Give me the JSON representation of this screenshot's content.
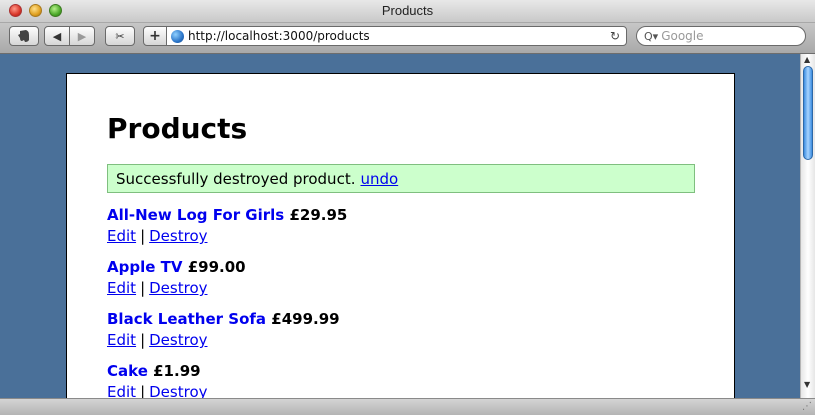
{
  "window": {
    "title": "Products"
  },
  "toolbar": {
    "evernote_icon": "evernote-elephant-icon",
    "back_icon": "◀",
    "forward_icon": "▶",
    "snippet_icon": "✂",
    "add_label": "+",
    "url": "http://localhost:3000/products",
    "reload_icon": "↻",
    "search_placeholder": "Google",
    "search_icon": "Q▾"
  },
  "page": {
    "title": "Products",
    "notice": {
      "text": "Successfully destroyed product.",
      "link": "undo"
    },
    "products": [
      {
        "name": "All-New Log For Girls",
        "price": "£29.95",
        "edit": "Edit",
        "destroy": "Destroy",
        "separator": "|"
      },
      {
        "name": "Apple TV",
        "price": "£99.00",
        "edit": "Edit",
        "destroy": "Destroy",
        "separator": "|"
      },
      {
        "name": "Black Leather Sofa",
        "price": "£499.99",
        "edit": "Edit",
        "destroy": "Destroy",
        "separator": "|"
      },
      {
        "name": "Cake",
        "price": "£1.99",
        "edit": "Edit",
        "destroy": "Destroy",
        "separator": "|"
      }
    ]
  },
  "colors": {
    "desktop_bg": "#4a7099",
    "notice_bg": "#ccffcc",
    "link": "#0000ee"
  }
}
